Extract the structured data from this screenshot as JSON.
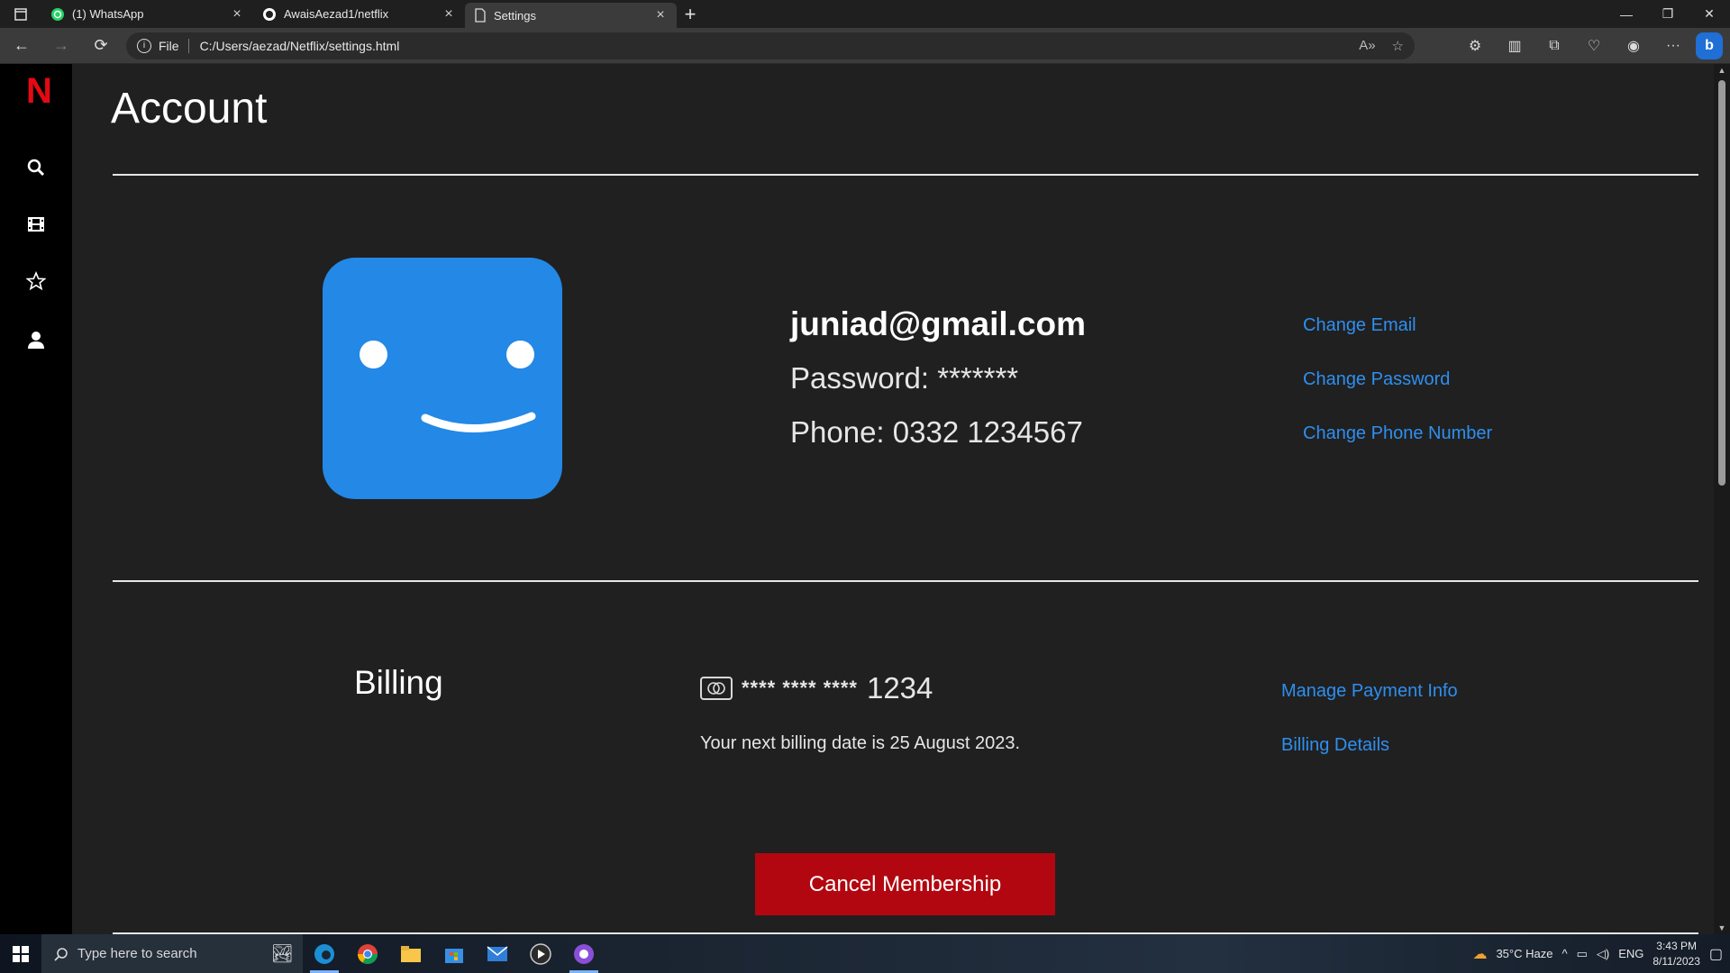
{
  "browser": {
    "tabs": [
      {
        "label": "(1) WhatsApp",
        "icon": "whatsapp-icon"
      },
      {
        "label": "AwaisAezad1/netflix",
        "icon": "github-icon"
      },
      {
        "label": "Settings",
        "icon": "page-icon",
        "active": true
      }
    ],
    "address": {
      "scheme_label": "File",
      "url": "C:/Users/aezad/Netflix/settings.html"
    }
  },
  "sidenav": {
    "logo": "N",
    "items": [
      "search-icon",
      "film-icon",
      "star-icon",
      "user-icon"
    ]
  },
  "account": {
    "title": "Account",
    "email": "juniad@gmail.com",
    "password_label": "Password: *******",
    "phone_label": "Phone: 0332 1234567",
    "links": {
      "change_email": "Change Email",
      "change_password": "Change Password",
      "change_phone": "Change Phone Number"
    }
  },
  "billing": {
    "title": "Billing",
    "card_mask": "**** **** ****",
    "card_last4": "1234",
    "next_billing": "Your next billing date is 25 August 2023.",
    "links": {
      "manage_payment": "Manage Payment Info",
      "billing_details": "Billing Details"
    }
  },
  "cancel_button": "Cancel Membership",
  "taskbar": {
    "search_placeholder": "Type here to search",
    "weather": "35°C  Haze",
    "language": "ENG",
    "time": "3:43 PM",
    "date": "8/11/2023"
  },
  "colors": {
    "accent": "#2e8ff0",
    "netflix_red": "#e50914",
    "cancel_red": "#b20710",
    "avatar_blue": "#2388e6"
  }
}
